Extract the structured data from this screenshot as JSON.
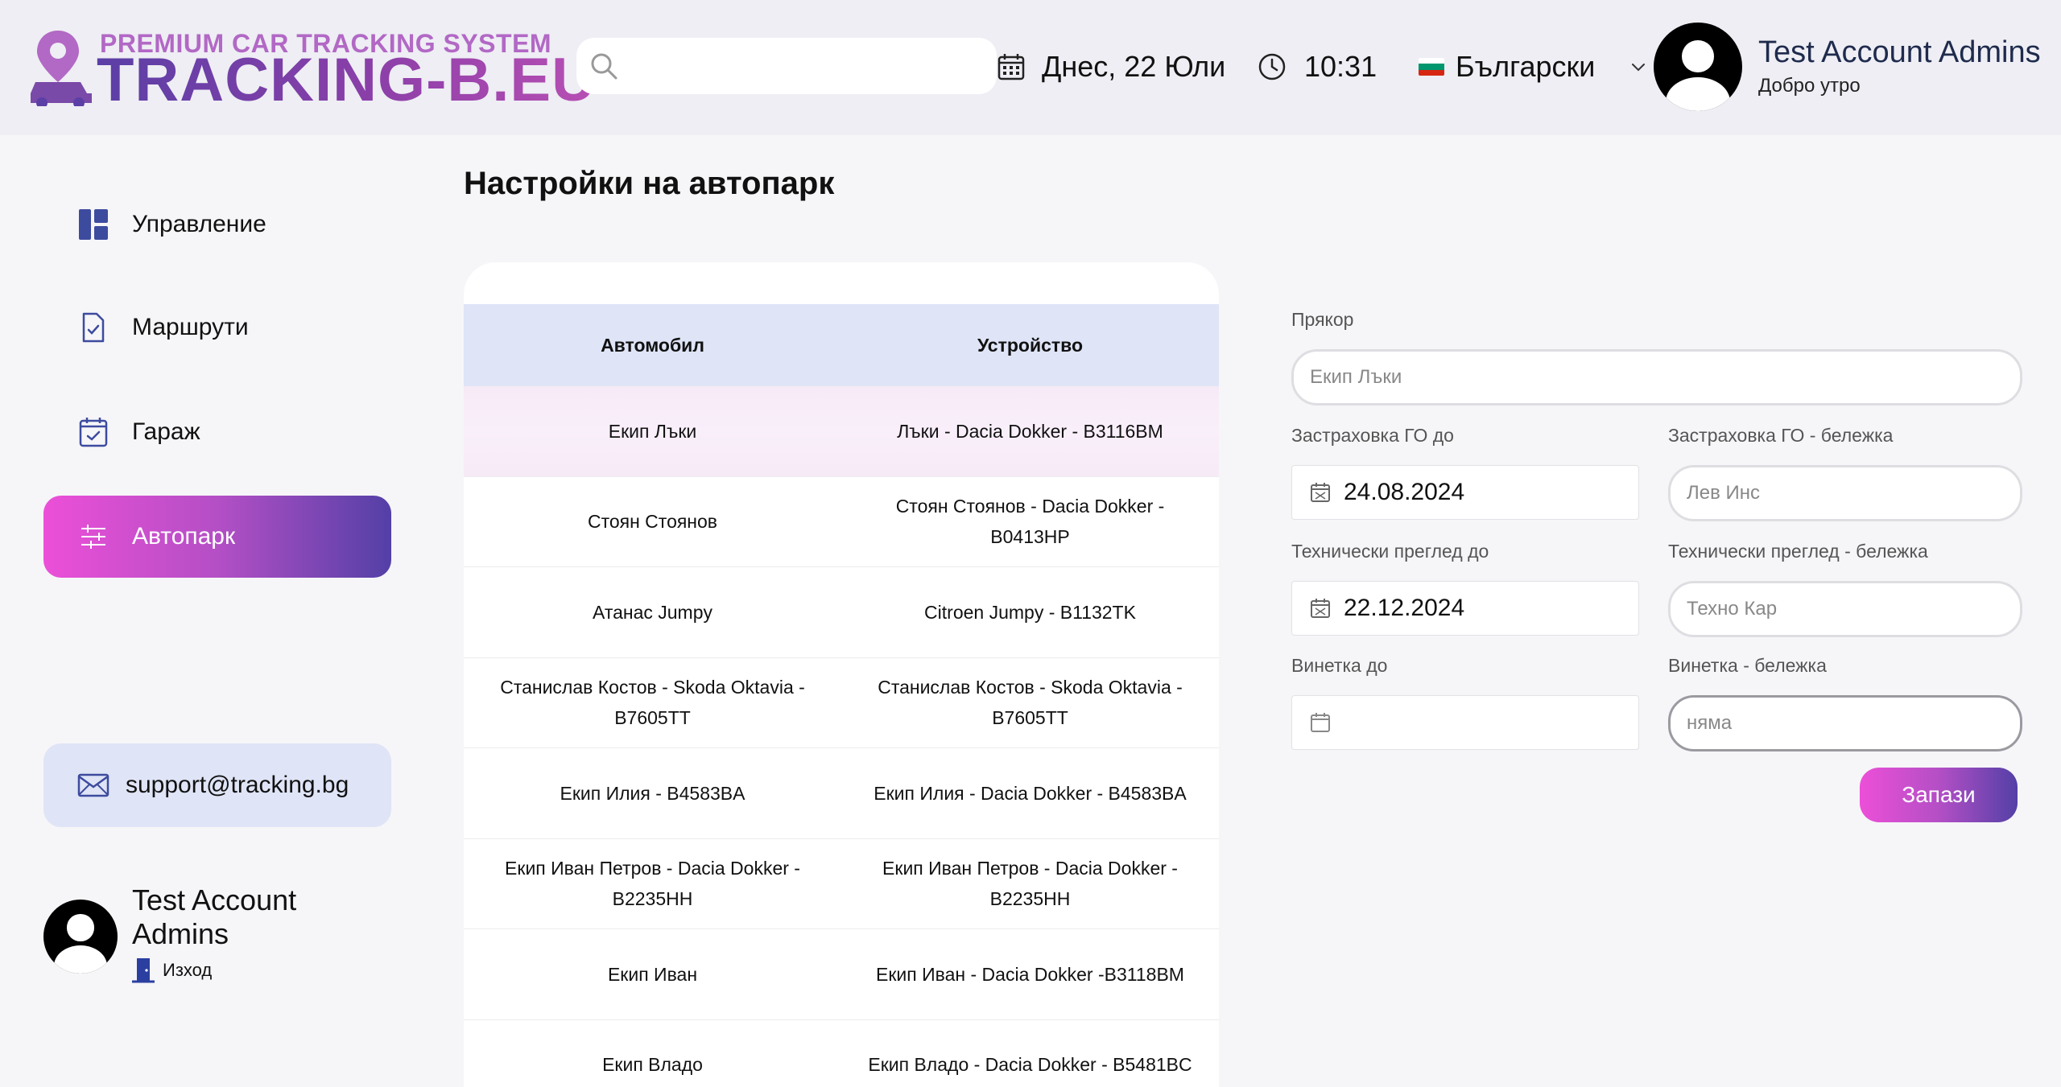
{
  "brand": {
    "tagline": "PREMIUM CAR TRACKING SYSTEM",
    "name": "TRACKING-B.EU"
  },
  "header": {
    "search_placeholder": "",
    "date": "Днес, 22 Юли",
    "time": "10:31",
    "language": "Български",
    "user_name": "Test Account Admins",
    "greeting": "Добро утро"
  },
  "sidebar": {
    "items": [
      {
        "label": "Управление",
        "icon": "dashboard-icon",
        "active": false
      },
      {
        "label": "Маршрути",
        "icon": "file-check-icon",
        "active": false
      },
      {
        "label": "Гараж",
        "icon": "calendar-check-icon",
        "active": false
      },
      {
        "label": "Автопарк",
        "icon": "sliders-icon",
        "active": true
      }
    ],
    "support_email": "support@tracking.bg",
    "user_name": "Test Account Admins",
    "logout_label": "Изход"
  },
  "main": {
    "title": "Настройки на автопарк",
    "table": {
      "columns": [
        "Автомобил",
        "Устройство"
      ],
      "rows": [
        {
          "car": "Екип Лъки",
          "device": "Лъки - Dacia Dokker - B3116BM",
          "selected": true
        },
        {
          "car": "Стоян Стоянов",
          "device": "Стоян Стоянов - Dacia Dokker - B0413HP",
          "selected": false
        },
        {
          "car": "Атанас Jumpy",
          "device": "Citroen Jumpy - B1132TK",
          "selected": false
        },
        {
          "car": "Станислав Костов - Skoda Oktavia - B7605TT",
          "device": "Станислав Костов - Skoda Oktavia - B7605TT",
          "selected": false
        },
        {
          "car": "Екип Илия - B4583BA",
          "device": "Екип Илия - Dacia Dokker - B4583BA",
          "selected": false
        },
        {
          "car": "Екип Иван Петров - Dacia Dokker - B2235HH",
          "device": "Екип Иван Петров - Dacia Dokker - B2235HH",
          "selected": false
        },
        {
          "car": "Екип Иван",
          "device": "Екип Иван - Dacia Dokker -B3118BM",
          "selected": false
        },
        {
          "car": "Екип Владо",
          "device": "Екип Владо - Dacia Dokker - B5481BC",
          "selected": false
        }
      ]
    },
    "form": {
      "nickname_label": "Прякор",
      "nickname_value": "Екип Лъки",
      "insurance_label": "Застраховка ГО до",
      "insurance_value": "24.08.2024",
      "insurance_note_label": "Застраховка ГО - бележка",
      "insurance_note_value": "Лев Инс",
      "inspection_label": "Технически преглед до",
      "inspection_value": "22.12.2024",
      "inspection_note_label": "Технически преглед - бележка",
      "inspection_note_value": "Техно Кар",
      "vignette_label": "Винетка до",
      "vignette_value": "",
      "vignette_note_label": "Винетка - бележка",
      "vignette_note_value": "няма",
      "save_label": "Запази"
    }
  },
  "colors": {
    "accent_pink": "#ec4fd8",
    "accent_purple": "#5340a6",
    "table_header": "#dfe5f7",
    "support_bg": "#dfe4f6"
  }
}
